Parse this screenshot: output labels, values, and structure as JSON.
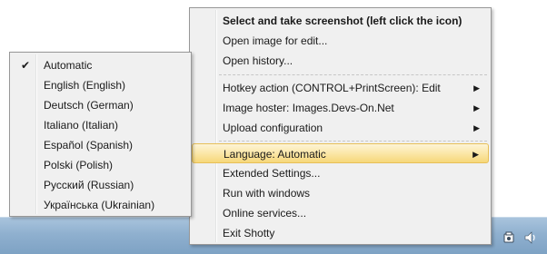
{
  "main_menu": {
    "items": [
      {
        "label": "Select and take screenshot (left click the icon)",
        "bold": true
      },
      {
        "label": "Open image for edit..."
      },
      {
        "label": "Open history..."
      },
      {
        "label": "Hotkey action (CONTROL+PrintScreen): Edit",
        "submenu": true
      },
      {
        "label": "Image hoster: Images.Devs-On.Net",
        "submenu": true
      },
      {
        "label": "Upload configuration",
        "submenu": true
      },
      {
        "label": "Language: Automatic",
        "submenu": true,
        "highlighted": true
      },
      {
        "label": "Extended Settings..."
      },
      {
        "label": "Run with windows"
      },
      {
        "label": "Online services..."
      },
      {
        "label": "Exit Shotty"
      }
    ],
    "submenu_arrow": "▶"
  },
  "language_menu": {
    "items": [
      {
        "label": "Automatic",
        "checked": true
      },
      {
        "label": "English (English)"
      },
      {
        "label": "Deutsch (German)"
      },
      {
        "label": "Italiano (Italian)"
      },
      {
        "label": "Español (Spanish)"
      },
      {
        "label": "Polski (Polish)"
      },
      {
        "label": "Русский (Russian)"
      },
      {
        "label": "Українська (Ukrainian)"
      }
    ],
    "check_mark": "✔"
  },
  "tray": {
    "icons": [
      "shotty-tray-icon",
      "volume-icon"
    ]
  }
}
